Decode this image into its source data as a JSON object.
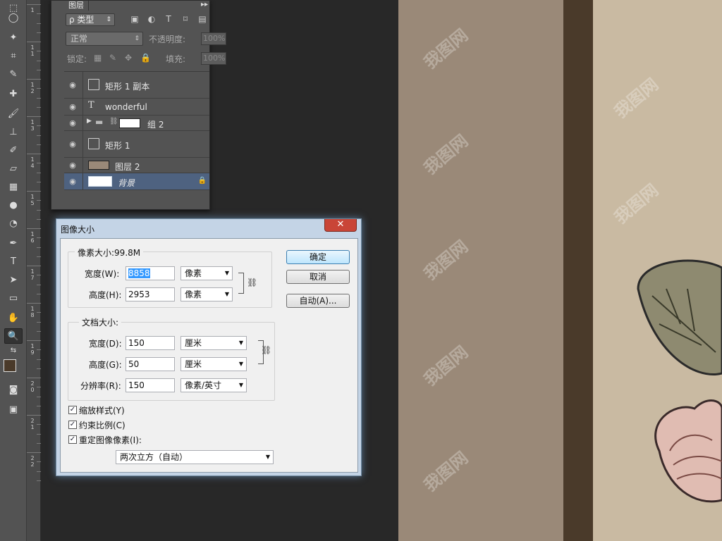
{
  "layers_panel": {
    "tab_label": "图层",
    "collapse_label": "▸▸",
    "filter_kind": "ρ 类型",
    "blend_mode": "正常",
    "opacity_label": "不透明度:",
    "opacity_value": "100%",
    "lock_label": "锁定:",
    "fill_label": "填充:",
    "fill_value": "100%",
    "layers": [
      {
        "name": "矩形 1 副本"
      },
      {
        "name": "wonderful"
      },
      {
        "name": "组 2"
      },
      {
        "name": "矩形 1"
      },
      {
        "name": "图层 2"
      },
      {
        "name": "背景"
      }
    ]
  },
  "ruler": {
    "labels": [
      "1",
      "1\n1",
      "1\n2",
      "1\n3",
      "1\n4",
      "1\n5",
      "1\n6",
      "1\n7",
      "1\n8",
      "1\n9",
      "2\n0",
      "2\n1",
      "2\n2"
    ]
  },
  "dialog": {
    "title": "图像大小",
    "close_label": "✕",
    "pixel_size_legend": "像素大小:99.8M",
    "width_label": "宽度(W):",
    "width_value": "8858",
    "width_unit": "像素",
    "height_label": "高度(H):",
    "height_value": "2953",
    "height_unit": "像素",
    "doc_size_legend": "文档大小:",
    "doc_width_label": "宽度(D):",
    "doc_width_value": "150",
    "doc_width_unit": "厘米",
    "doc_height_label": "高度(G):",
    "doc_height_value": "50",
    "doc_height_unit": "厘米",
    "resolution_label": "分辨率(R):",
    "resolution_value": "150",
    "resolution_unit": "像素/英寸",
    "scale_styles_label": "缩放样式(Y)",
    "constrain_label": "约束比例(C)",
    "resample_label": "重定图像像素(I):",
    "resample_method": "两次立方（自动）",
    "ok_label": "确定",
    "cancel_label": "取消",
    "auto_label": "自动(A)..."
  },
  "watermark_text": "我图网",
  "colors": {
    "foreground": "#4a3a2a",
    "background": "#ffffff",
    "selection": "#4e6280"
  }
}
